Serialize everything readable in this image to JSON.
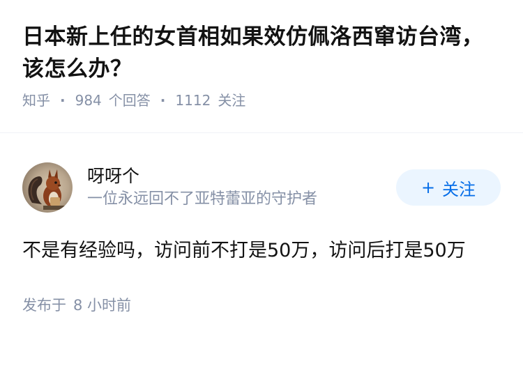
{
  "question": {
    "title": "日本新上任的女首相如果效仿佩洛西窜访台湾，该怎么办？",
    "source": "知乎",
    "answer_count": "984",
    "answer_count_label": "个回答",
    "follower_count": "1112",
    "follower_label": "关注"
  },
  "answer": {
    "author_name": "呀呀个",
    "author_bio": "一位永远回不了亚特蕾亚的守护者",
    "follow_button": {
      "icon": "+",
      "label": "关注"
    },
    "content": "不是有经验吗，访问前不打是50万，访问后打是50万",
    "time_prefix": "发布于",
    "time_value": "8 小时前"
  },
  "colors": {
    "text_primary": "#121212",
    "text_secondary": "#8590a6",
    "accent": "#056de8",
    "button_bg": "#ebf5ff"
  },
  "icons": {
    "avatar": "squirrel-avatar"
  }
}
